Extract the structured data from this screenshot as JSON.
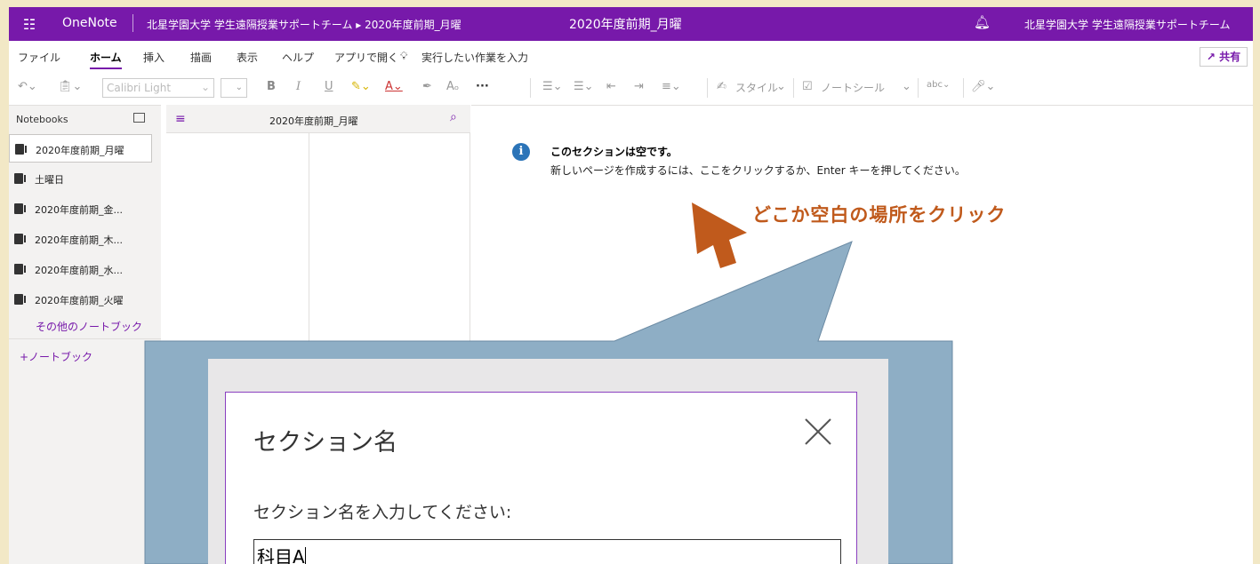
{
  "titlebar": {
    "app_name": "OneNote",
    "breadcrumb": "北星学園大学 学生遠隔授業サポートチーム ▸ 2020年度前期_月曜",
    "document_title": "2020年度前期_月曜",
    "user_name": "北星学園大学 学生遠隔授業サポートチーム"
  },
  "menubar": {
    "items": [
      "ファイル",
      "ホーム",
      "挿入",
      "描画",
      "表示",
      "ヘルプ",
      "アプリで開く"
    ],
    "search_hint": "実行したい作業を入力",
    "share_label": "共有",
    "active_item": "ホーム"
  },
  "toolbar": {
    "font_name": "Calibri Light",
    "styles_label": "スタイル",
    "tags_label": "ノートシール",
    "more_label": "···"
  },
  "notebooks": {
    "header": "Notebooks",
    "items": [
      {
        "label": "2020年度前期_月曜",
        "selected": true
      },
      {
        "label": "土曜日",
        "selected": false
      },
      {
        "label": "2020年度前期_金...",
        "selected": false
      },
      {
        "label": "2020年度前期_木...",
        "selected": false
      },
      {
        "label": "2020年度前期_水...",
        "selected": false
      },
      {
        "label": "2020年度前期_火曜",
        "selected": false
      }
    ],
    "more_label": "その他のノートブック",
    "add_label": "+ノートブック"
  },
  "section_list": {
    "title": "2020年度前期_月曜"
  },
  "canvas": {
    "info_title": "このセクションは空です。",
    "info_body": "新しいページを作成するには、ここをクリックするか、Enter キーを押してください。"
  },
  "annotation": {
    "callout_text": "どこか空白の場所をクリック",
    "arrow_color": "#c05a1c",
    "bubble_color": "#8eaec5"
  },
  "dialog": {
    "title": "セクション名",
    "prompt_label": "セクション名を入力してください:",
    "input_value": "科目A"
  },
  "colors": {
    "accent": "#7719aa",
    "background_border": "#f2e8c6"
  }
}
